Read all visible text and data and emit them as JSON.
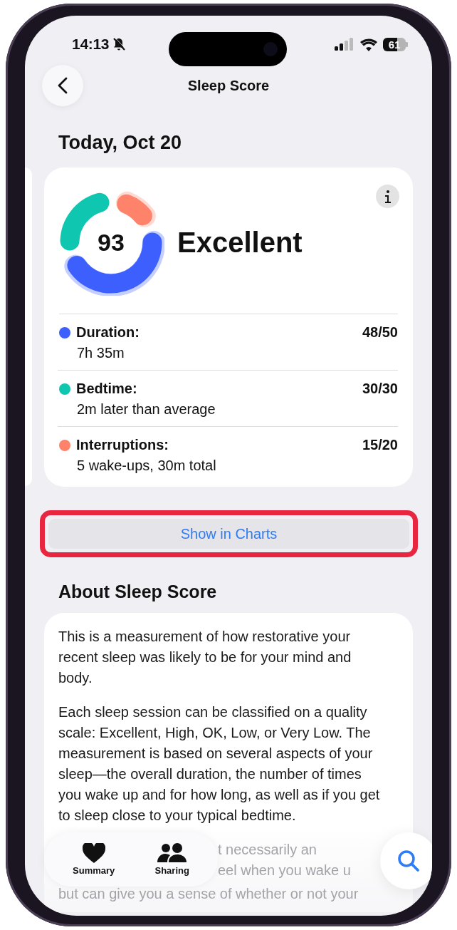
{
  "status_bar": {
    "time": "14:13",
    "battery": "61"
  },
  "nav": {
    "title": "Sleep Score"
  },
  "date_heading": "Today, Oct 20",
  "score": {
    "value": "93",
    "rating": "Excellent"
  },
  "components": [
    {
      "name": "Duration:",
      "detail": "7h 35m",
      "points": "48/50",
      "color": "#3d5ffe"
    },
    {
      "name": "Bedtime:",
      "detail": "2m later than average",
      "points": "30/30",
      "color": "#0fc6b0"
    },
    {
      "name": "Interruptions:",
      "detail": "5 wake-ups, 30m total",
      "points": "15/20",
      "color": "#ff826a"
    }
  ],
  "chart_button": "Show in Charts",
  "about": {
    "heading": "About Sleep Score",
    "paragraphs": [
      "This is a measurement of how restorative your recent sleep was likely to be for your mind and body.",
      "Each sleep session can be classified on a quality scale: Excellent, High, OK, Low, or Very Low. The measurement is based on several aspects of your sleep—the overall duration, the number of times you wake up and for how long, as well as if you get to sleep close to your typical bedtime."
    ],
    "faded_lines": [
      "t necessarily an",
      "eel when you wake u",
      "but can give you a sense of whether or not your"
    ]
  },
  "tab_bar": {
    "tabs": [
      {
        "label": "Summary",
        "selected": false,
        "kind": "heart"
      },
      {
        "label": "Sharing",
        "selected": false,
        "kind": "people"
      }
    ]
  }
}
